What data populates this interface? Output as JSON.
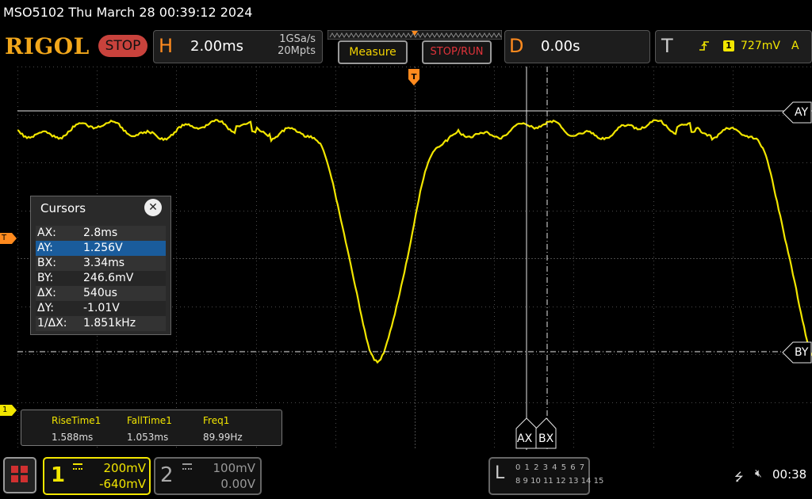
{
  "title": "MSO5102  Thu March 28 00:39:12 2024",
  "brand": "RIGOL",
  "run_state": "STOP",
  "horizontal": {
    "letter": "H",
    "timebase": "2.00ms",
    "sample_rate": "1GSa/s",
    "memory_depth": "20Mpts"
  },
  "toolbar": {
    "measure_label": "Measure",
    "stop_run_label": "STOP/RUN"
  },
  "delay": {
    "letter": "D",
    "value": "0.00s"
  },
  "trigger": {
    "letter": "T",
    "source": "1",
    "level": "727mV",
    "mode": "A",
    "slope_icon": "rising-edge-icon"
  },
  "markers": {
    "trigger_pos": "T",
    "trigger_level": "T",
    "channel1": "1",
    "ay": "AY",
    "by": "BY",
    "ax": "AX",
    "bx": "BX"
  },
  "cursors": {
    "title": "Cursors",
    "rows": [
      {
        "key": "AX:",
        "value": "2.8ms"
      },
      {
        "key": "AY:",
        "value": "1.256V"
      },
      {
        "key": "BX:",
        "value": "3.34ms"
      },
      {
        "key": "BY:",
        "value": "246.6mV"
      },
      {
        "key": "ΔX:",
        "value": "540us"
      },
      {
        "key": "ΔY:",
        "value": "-1.01V"
      },
      {
        "key": "1/ΔX:",
        "value": "1.851kHz"
      }
    ]
  },
  "measurements": [
    {
      "label": "RiseTime1",
      "value": "1.588ms"
    },
    {
      "label": "FallTime1",
      "value": "1.053ms"
    },
    {
      "label": "Freq1",
      "value": "89.99Hz"
    }
  ],
  "channels": [
    {
      "num": "1",
      "scale": "200mV",
      "offset": "-640mV",
      "color": "#f2e600"
    },
    {
      "num": "2",
      "scale": "100mV",
      "offset": "0.00V",
      "color": "#999999"
    }
  ],
  "logic": {
    "letter": "L",
    "row1": "0 1 2 3  4 5 6 7",
    "row2": "8 9 10 11 12 13 14 15"
  },
  "status": {
    "clock": "00:38",
    "usb_icon": "usb-icon",
    "speaker_icon": "speaker-muted-icon"
  },
  "colors": {
    "trace": "#f2e600",
    "accent": "#ff8a1e",
    "logo": "#f2a71b",
    "stop": "#c8423c"
  }
}
